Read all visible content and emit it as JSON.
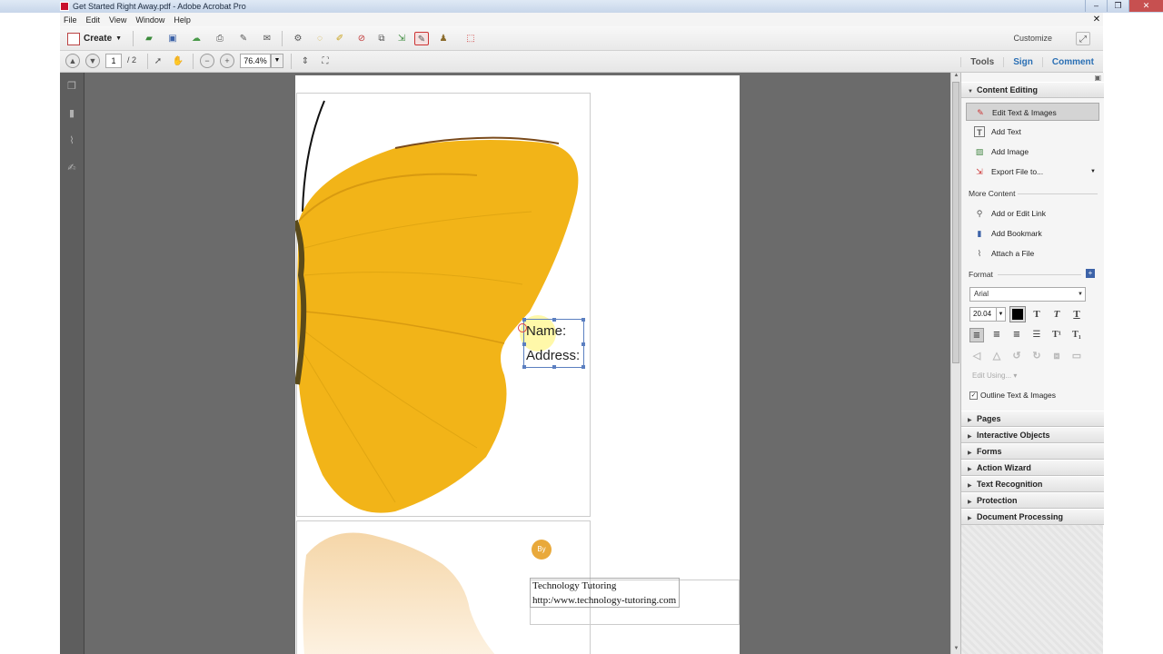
{
  "window": {
    "title": "Get Started Right Away.pdf - Adobe Acrobat Pro"
  },
  "menu": [
    "File",
    "Edit",
    "View",
    "Window",
    "Help"
  ],
  "toolbar": {
    "create_label": "Create",
    "customize_label": "Customize"
  },
  "nav": {
    "current_page": "1",
    "page_total": "/ 2",
    "zoom": "76.4%"
  },
  "top_links": {
    "tools": "Tools",
    "sign": "Sign",
    "comment": "Comment"
  },
  "document": {
    "name_label": "Name:",
    "address_label": "Address:",
    "badge": "By",
    "contact_line1": "Technology Tutoring",
    "contact_line2": "http:/www.technology-tutoring.com"
  },
  "panel": {
    "content_editing": "Content Editing",
    "edit_text_images": "Edit Text & Images",
    "add_text": "Add Text",
    "add_image": "Add Image",
    "export_file": "Export File to...",
    "more_content": "More Content",
    "add_edit_link": "Add or Edit Link",
    "add_bookmark": "Add Bookmark",
    "attach_file": "Attach a File",
    "format": "Format",
    "font": "Arial",
    "font_size": "20.04",
    "edit_using": "Edit Using...",
    "outline_label": "Outline Text & Images",
    "sections": [
      "Pages",
      "Interactive Objects",
      "Forms",
      "Action Wizard",
      "Text Recognition",
      "Protection",
      "Document Processing"
    ]
  },
  "colors": {
    "accent": "#2a6fb4",
    "badge": "#e9a93b",
    "butterfly": "#f2b418",
    "selection": "#5b7fc0"
  }
}
